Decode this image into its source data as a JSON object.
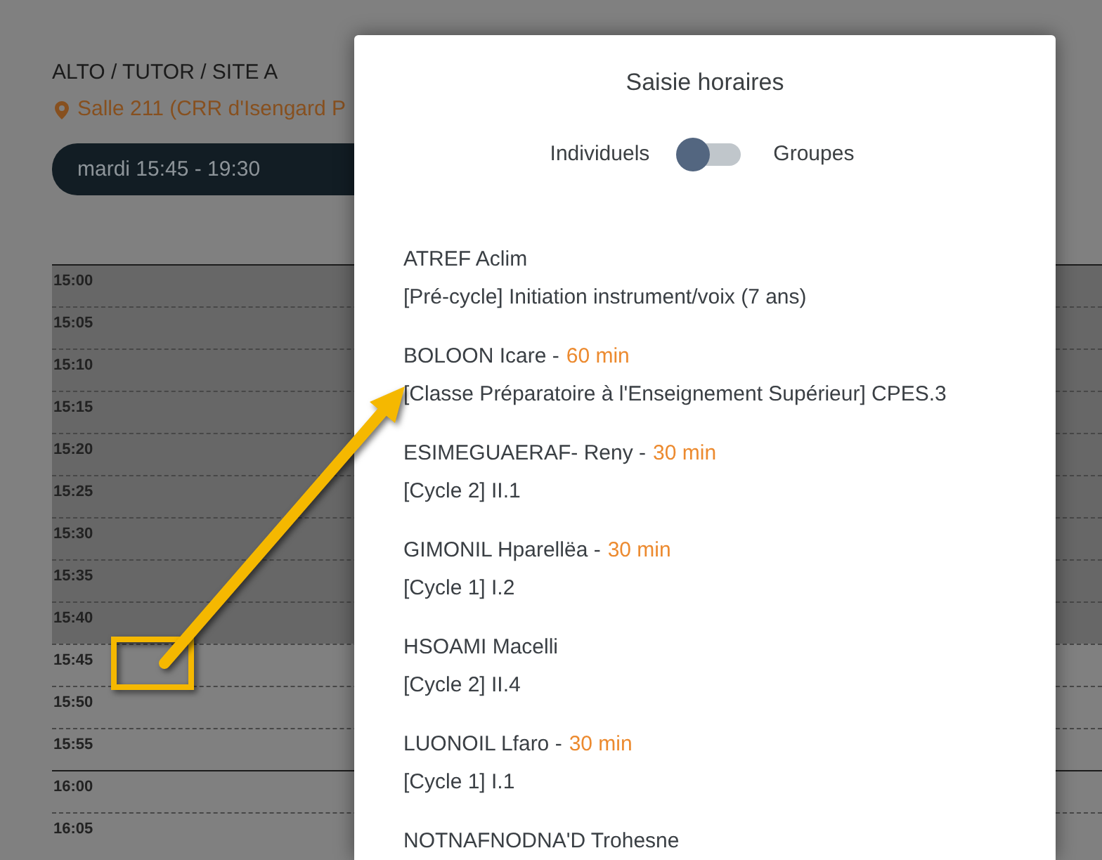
{
  "page": {
    "breadcrumb": "ALTO / TUTOR / SITE A",
    "location": "Salle 211 (CRR d'Isengard P",
    "schedule": "mardi 15:45 - 19:30"
  },
  "calendar": {
    "slots": [
      {
        "time": "15:00",
        "available": false
      },
      {
        "time": "15:05",
        "available": false
      },
      {
        "time": "15:10",
        "available": false
      },
      {
        "time": "15:15",
        "available": false
      },
      {
        "time": "15:20",
        "available": false
      },
      {
        "time": "15:25",
        "available": false
      },
      {
        "time": "15:30",
        "available": false
      },
      {
        "time": "15:35",
        "available": false
      },
      {
        "time": "15:40",
        "available": false
      },
      {
        "time": "15:45",
        "available": true
      },
      {
        "time": "15:50",
        "available": true
      },
      {
        "time": "15:55",
        "available": true
      },
      {
        "time": "16:00",
        "available": true
      },
      {
        "time": "16:05",
        "available": true
      }
    ]
  },
  "dialog": {
    "title": "Saisie horaires",
    "toggle": {
      "left_label": "Individuels",
      "right_label": "Groupes",
      "on": false
    },
    "students": [
      {
        "name": "ATREF Aclim",
        "course": "[Pré-cycle] Initiation instrument/voix (7 ans)"
      },
      {
        "name": "BOLOON Icare -",
        "duration": "60 min",
        "course": "[Classe Préparatoire à l'Enseignement Supérieur] CPES.3"
      },
      {
        "name": "ESIMEGUAERAF- Reny -",
        "duration": "30 min",
        "course": "[Cycle 2] II.1"
      },
      {
        "name": "GIMONIL Hparellëa -",
        "duration": "30 min",
        "course": "[Cycle 1] I.2"
      },
      {
        "name": "HSOAMI Macelli",
        "course": "[Cycle 2] II.4"
      },
      {
        "name": "LUONOIL Lfaro -",
        "duration": "30 min",
        "course": "[Cycle 1] I.1"
      },
      {
        "name": "NOTNAFNODNA'D Trohesne"
      }
    ]
  }
}
